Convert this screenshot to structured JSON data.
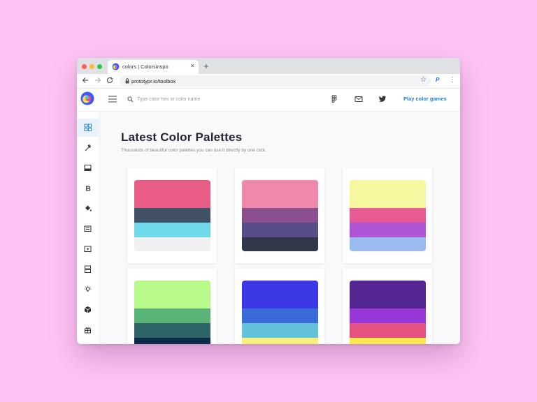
{
  "browser": {
    "tab_title": "colors | Colorsinspo",
    "url": "prototypr.io/toolbox"
  },
  "header": {
    "search_placeholder": "Type color hex or color name",
    "play_label": "Play color games"
  },
  "sidebar": {
    "items": [
      {
        "icon": "grid-icon",
        "active": true
      },
      {
        "icon": "eyedropper-icon",
        "active": false
      },
      {
        "icon": "image-icon",
        "active": false
      },
      {
        "icon": "bold-icon",
        "active": false
      },
      {
        "icon": "paint-bucket-icon",
        "active": false
      },
      {
        "icon": "newspaper-icon",
        "active": false
      },
      {
        "icon": "play-icon",
        "active": false
      },
      {
        "icon": "layout-icon",
        "active": false
      },
      {
        "icon": "lightbulb-icon",
        "active": false
      },
      {
        "icon": "cube-icon",
        "active": false
      },
      {
        "icon": "gift-icon",
        "active": false
      }
    ]
  },
  "main": {
    "title": "Latest Color Palettes",
    "subtitle": "Thousands of beautiful color palettes you can use it directly by one click.",
    "palettes": [
      [
        "#e85c86",
        "#3f5266",
        "#6ed9e8",
        "#f0f0f0"
      ],
      [
        "#ee89ac",
        "#8b4f90",
        "#584d87",
        "#313849"
      ],
      [
        "#f6f79f",
        "#e65b92",
        "#ad55d6",
        "#99bbf0"
      ],
      [
        "#b9fb8b",
        "#5ab477",
        "#2e6467",
        "#0b2b48"
      ],
      [
        "#3d38e6",
        "#3a6ad8",
        "#63c1d9",
        "#f8f07b"
      ],
      [
        "#542795",
        "#9837d8",
        "#e5527f",
        "#fbe94f"
      ]
    ]
  }
}
